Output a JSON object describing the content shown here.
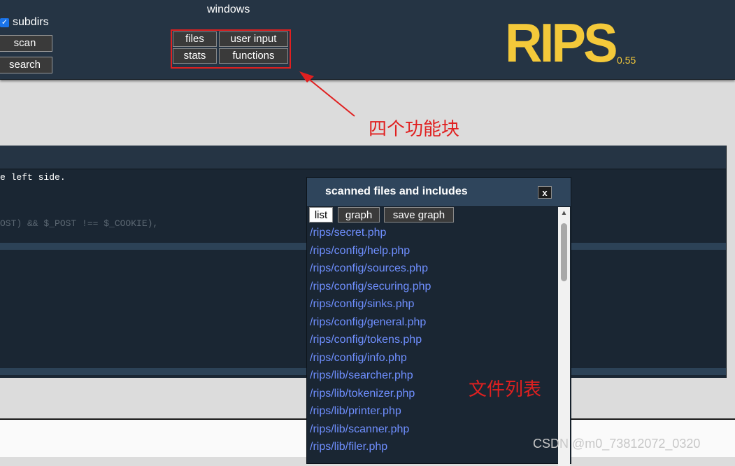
{
  "menu": {
    "subdirs_label": "subdirs",
    "scan_label": "scan",
    "search_label": "search",
    "windows_label": "windows",
    "window_buttons": [
      "files",
      "user input",
      "stats",
      "functions"
    ]
  },
  "logo": {
    "text": "RIPS",
    "version": "0.55"
  },
  "annotations": {
    "function_blocks": "四个功能块",
    "file_list": "文件列表"
  },
  "code": {
    "line1": "e left side.",
    "line2": "OST) && $_POST !== $_COOKIE),"
  },
  "files_window": {
    "title": "scanned files and includes",
    "close_label": "x",
    "tabs": [
      "list",
      "graph",
      "save graph"
    ],
    "files": [
      "/rips/secret.php",
      "/rips/config/help.php",
      "/rips/config/sources.php",
      "/rips/config/securing.php",
      "/rips/config/sinks.php",
      "/rips/config/general.php",
      "/rips/config/tokens.php",
      "/rips/config/info.php",
      "/rips/lib/searcher.php",
      "/rips/lib/tokenizer.php",
      "/rips/lib/printer.php",
      "/rips/lib/scanner.php",
      "/rips/lib/filer.php"
    ]
  },
  "watermark": "CSDN @m0_73812072_0320",
  "colors": {
    "accent": "#f4c93a",
    "link": "#6f8fff",
    "annotation": "#e02020"
  }
}
